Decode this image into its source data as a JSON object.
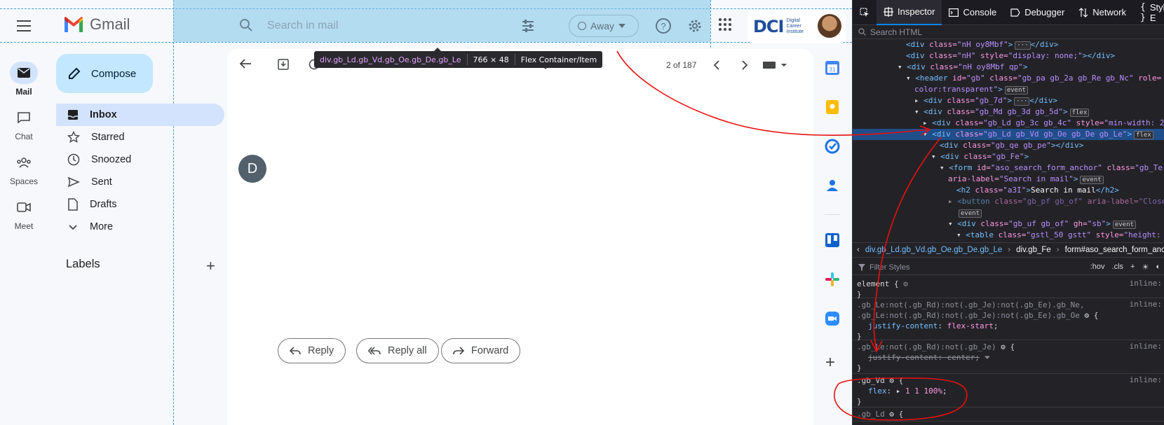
{
  "gmail": {
    "brand": "Gmail",
    "search_placeholder": "Search in mail",
    "status": "Away",
    "compose": "Compose",
    "rail": [
      {
        "label": "Mail",
        "icon": "mail-icon"
      },
      {
        "label": "Chat",
        "icon": "chat-icon"
      },
      {
        "label": "Spaces",
        "icon": "spaces-icon"
      },
      {
        "label": "Meet",
        "icon": "meet-icon"
      }
    ],
    "nav": [
      {
        "label": "Inbox",
        "icon": "inbox-icon"
      },
      {
        "label": "Starred",
        "icon": "star-icon"
      },
      {
        "label": "Snoozed",
        "icon": "clock-icon"
      },
      {
        "label": "Sent",
        "icon": "send-icon"
      },
      {
        "label": "Drafts",
        "icon": "draft-icon"
      },
      {
        "label": "More",
        "icon": "chevron-down-icon"
      }
    ],
    "labels_heading": "Labels",
    "pager": "2 of 187",
    "sender_initial": "D",
    "actions": {
      "reply": "Reply",
      "reply_all": "Reply all",
      "forward": "Forward"
    },
    "org_logo": {
      "mark": "DCI",
      "name": "Digital Career Institute"
    }
  },
  "tooltip": {
    "selector": "div.gb_Ld.gb_Vd.gb_Oe.gb_De.gb_Le",
    "size": "766 × 48",
    "kind": "Flex Container/Item"
  },
  "devtools": {
    "tabs": [
      "Inspector",
      "Console",
      "Debugger",
      "Network",
      "Style E"
    ],
    "search_placeholder": "Search HTML",
    "breadcrumbs": [
      "div.gb_Ld.gb_Vd.gb_Oe.gb_De.gb_Le",
      "div.gb_Fe",
      "form#aso_search_form_anch"
    ],
    "filter_placeholder": "Filter Styles",
    "toolbar": [
      ":hov",
      ".cls"
    ],
    "inline_label": "inline:"
  },
  "colors": {
    "compose_bg": "#c2e7ff",
    "active_nav": "#d3e3fd",
    "highlight_overlay": "#7dc4e6",
    "annotation_red": "#e8100f",
    "devtools_bg": "#232327"
  }
}
